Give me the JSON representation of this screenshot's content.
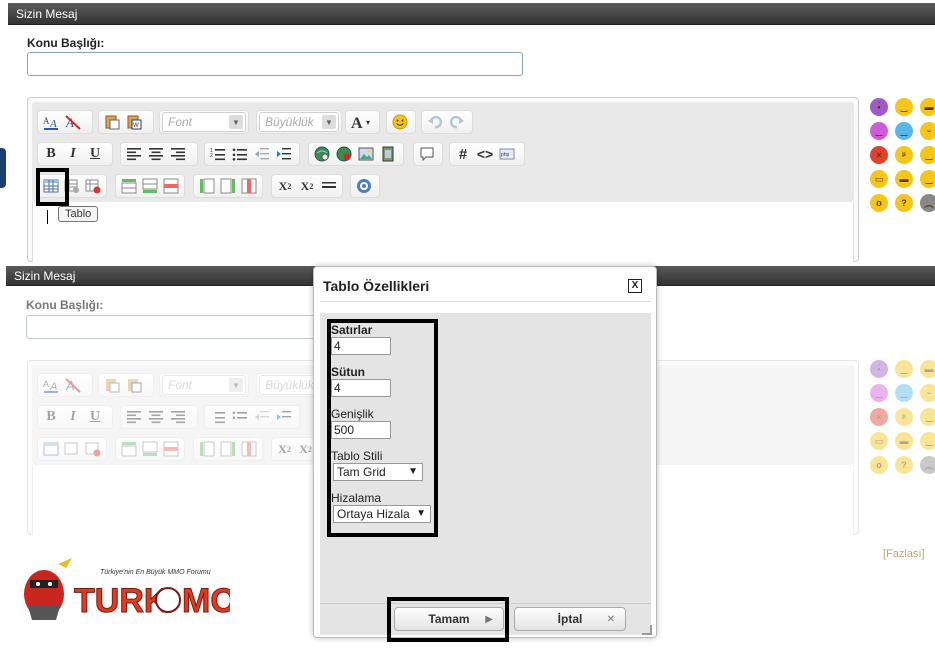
{
  "top_panel": {
    "header": "Sizin Mesaj",
    "subject_label": "Konu Başlığı:",
    "font_placeholder": "Font",
    "size_placeholder": "Büyüklük",
    "tooltip": "Tablo"
  },
  "bottom_panel": {
    "header": "Sizin Mesaj",
    "subject_label": "Konu Başlığı:",
    "font_placeholder": "Font",
    "size_placeholder": "Büyüklük",
    "more_link": "[Fazlası]"
  },
  "dialog": {
    "title": "Tablo Özellikleri",
    "close": "X",
    "rows_label": "Satırlar",
    "rows_value": "4",
    "cols_label": "Sütun",
    "cols_value": "4",
    "width_label": "Genişlik",
    "width_value": "500",
    "style_label": "Tablo Stili",
    "style_value": "Tam Grid",
    "align_label": "Hizalama",
    "align_value": "Ortaya Hizala",
    "ok_button": "Tamam",
    "cancel_button": "İptal"
  },
  "logo": {
    "tagline": "Türkiye'nin En Büyük MMO Forumu",
    "brand": "TURKMMO"
  },
  "icons": {
    "toolbar_row1": [
      "font-color-icon",
      "remove-format-icon",
      "paste-icon",
      "paste-word-icon",
      "text-size-icon",
      "smiley-icon",
      "undo-icon",
      "redo-icon"
    ],
    "toolbar_row2": [
      "bold-icon",
      "italic-icon",
      "underline-icon",
      "align-left-icon",
      "align-center-icon",
      "align-right-icon",
      "ordered-list-icon",
      "unordered-list-icon",
      "outdent-icon",
      "indent-icon",
      "link-icon",
      "unlink-icon",
      "image-icon",
      "video-icon",
      "quote-icon",
      "hash-icon",
      "code-icon",
      "php-icon"
    ],
    "toolbar_row3": [
      "table-icon",
      "table-props-icon",
      "delete-table-icon",
      "row-before-icon",
      "row-after-icon",
      "delete-row-icon",
      "col-before-icon",
      "col-after-icon",
      "delete-col-icon",
      "subscript-icon",
      "superscript-icon",
      "horizontal-rule-icon",
      "special-icon"
    ]
  },
  "colors": {
    "header_bg": "#3c3c3c",
    "highlight_border": "#000000",
    "more_link": "#c8a070",
    "smiley_yellow": "#f5c518"
  }
}
